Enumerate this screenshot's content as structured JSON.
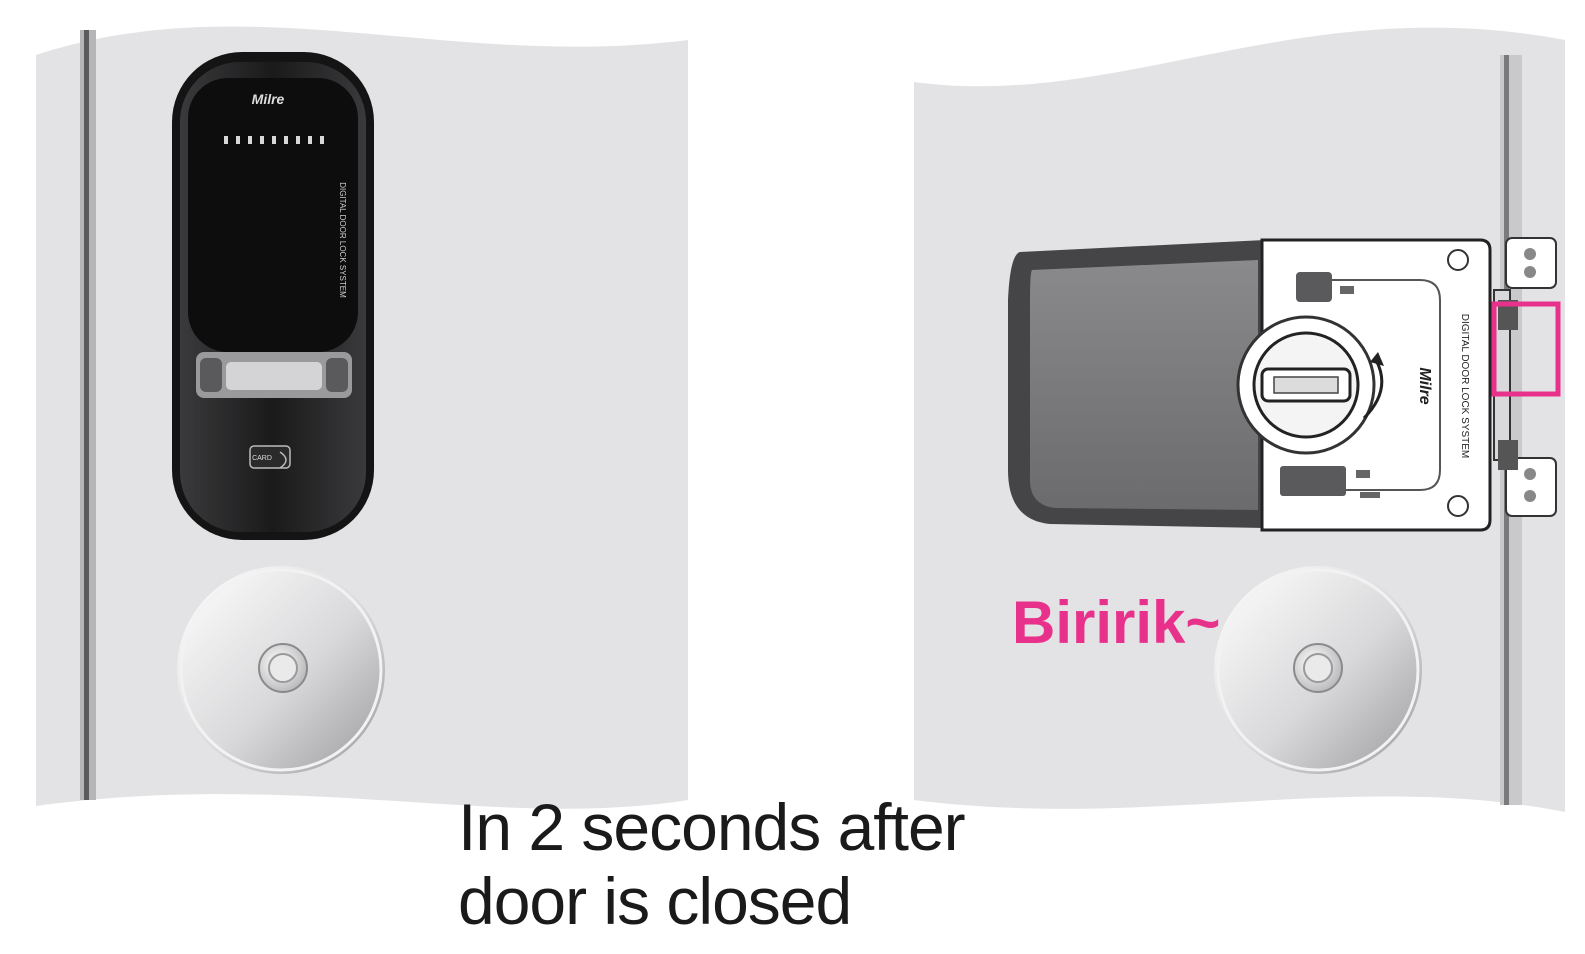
{
  "colors": {
    "accent": "#e8318b",
    "door": "#e3e3e5",
    "background": "#ffffff"
  },
  "outside_lock": {
    "brand": "Milre",
    "side_text": "DIGITAL DOOR LOCK SYSTEM",
    "card_label": "CARD"
  },
  "inside_lock": {
    "brand": "Milre",
    "side_text": "DIGITAL DOOR LOCK SYSTEM"
  },
  "sound_text": "Biririk~",
  "caption": {
    "line1": "In 2 seconds after",
    "line2": "door is closed"
  }
}
